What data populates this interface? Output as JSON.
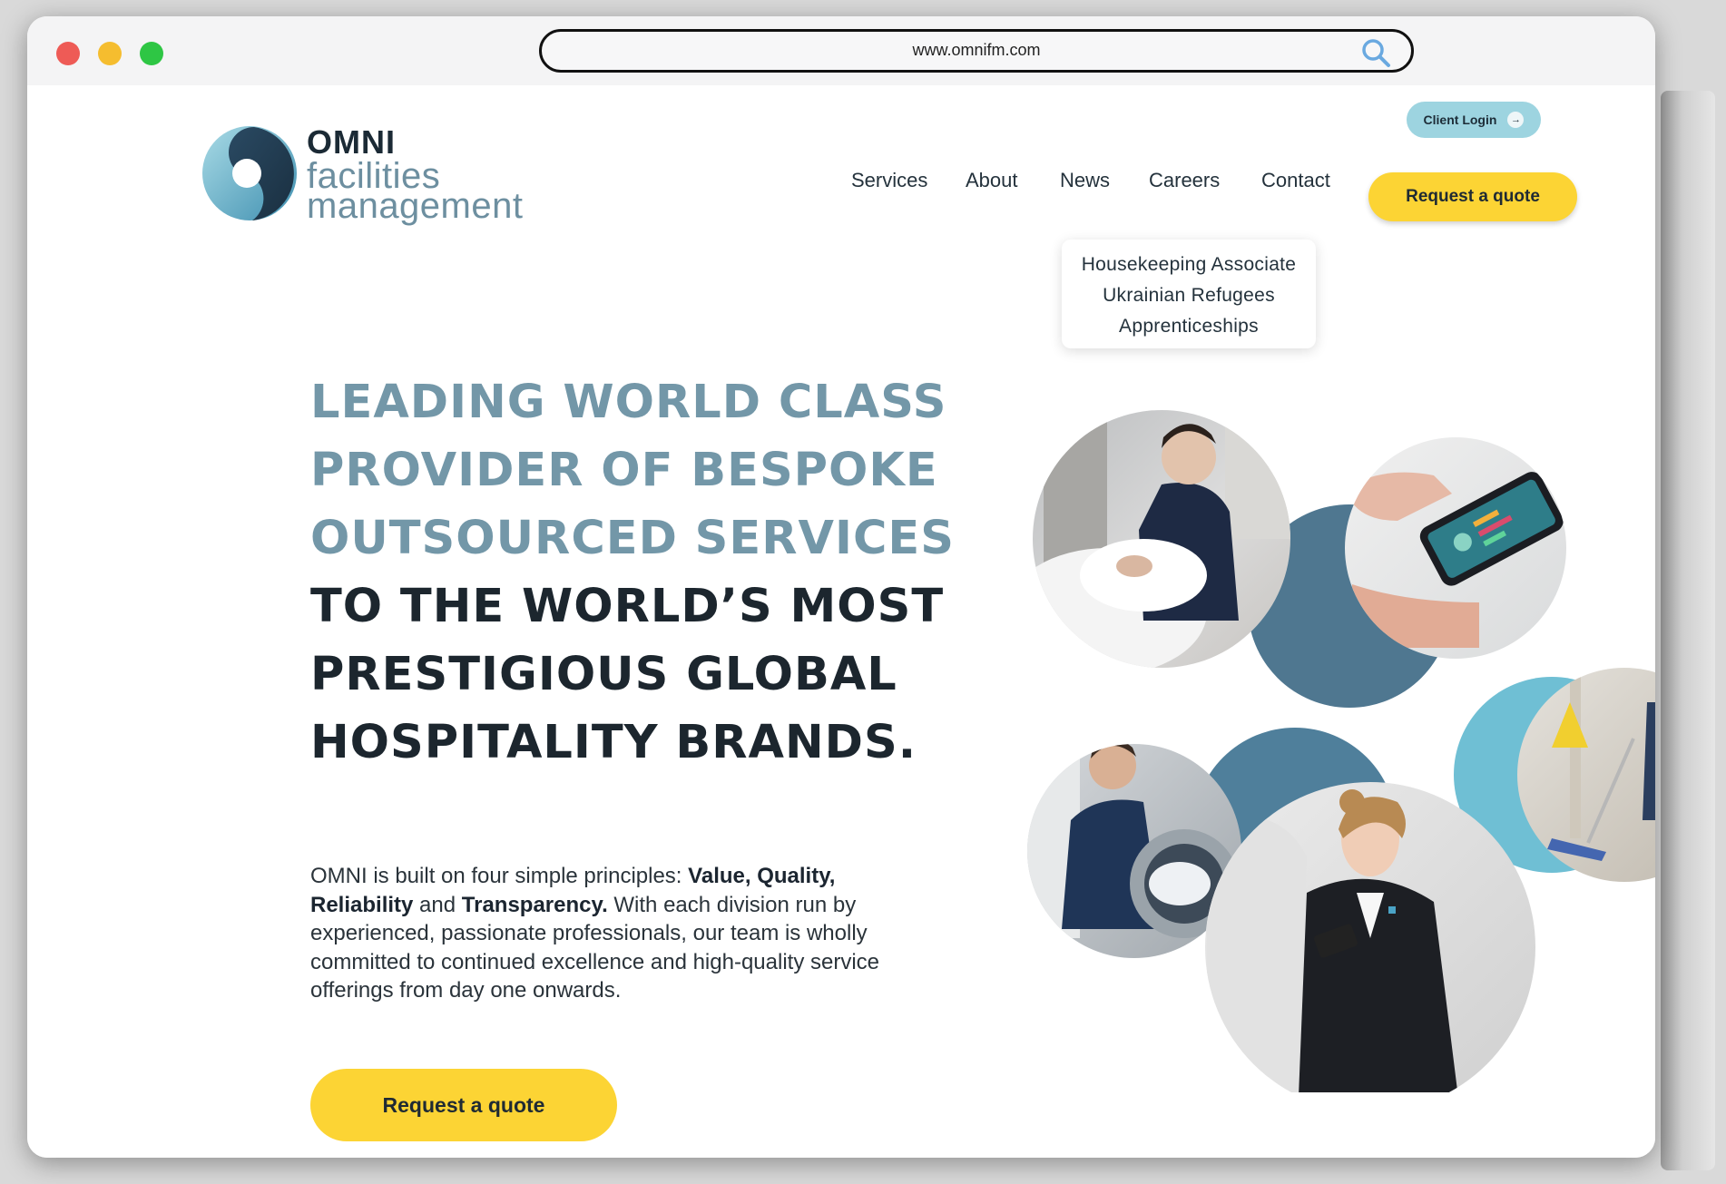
{
  "browser": {
    "url": "www.omnifm.com"
  },
  "logo": {
    "word": "OMNI",
    "line1": "facilities",
    "line2": "management"
  },
  "header": {
    "client_login": "Client Login",
    "nav": [
      {
        "label": "Services"
      },
      {
        "label": "About"
      },
      {
        "label": "News"
      },
      {
        "label": "Careers"
      },
      {
        "label": "Contact"
      }
    ],
    "cta": "Request a quote"
  },
  "careers_dropdown": {
    "items": [
      "Housekeeping Associate",
      "Ukrainian Refugees",
      "Apprenticeships"
    ]
  },
  "hero": {
    "headline_light": [
      "LEADING WORLD CLASS",
      "PROVIDER OF BESPOKE",
      "OUTSOURCED SERVICES"
    ],
    "headline_dark": [
      "TO THE WORLD’S MOST",
      "PRESTIGIOUS GLOBAL",
      "HOSPITALITY BRANDS."
    ],
    "body": {
      "intro": "OMNI is built on four simple principles: ",
      "p1": "Value, Quality,",
      "p2": "Reliability",
      "and": " and ",
      "p3": "Transparency.",
      "rest": " With each division run by experienced, passionate professionals, our team is wholly committed to continued excellence and high-quality service offerings from day one onwards."
    },
    "cta": "Request a quote"
  },
  "colors": {
    "accent_yellow": "#fcd434",
    "teal_light": "#9dd4e0",
    "slate_blue": "#7397a8",
    "dark_text": "#1c262e"
  }
}
